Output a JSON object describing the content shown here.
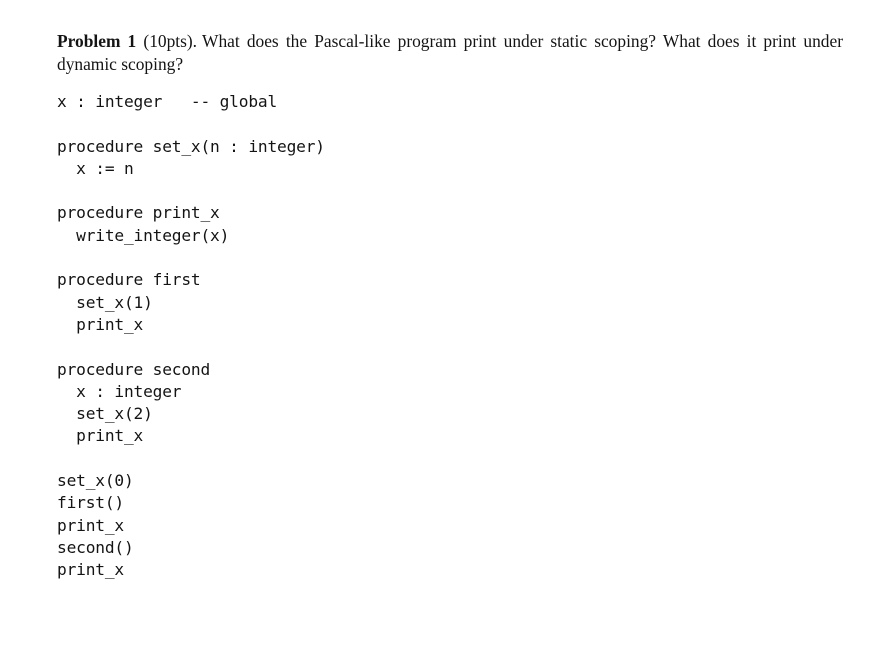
{
  "page": {
    "background_color": "#ffffff",
    "text_color": "#141414"
  },
  "problem": {
    "label": "Problem 1",
    "points": "(10pts).",
    "question": "What does the Pascal-like program print under static scoping? What does it print under dynamic scoping?"
  },
  "program": {
    "language": "Pascal-like pseudocode",
    "blocks": [
      {
        "name": "global-declaration",
        "lines": [
          "x : integer   -- global"
        ]
      },
      {
        "name": "procedure-set-x",
        "lines": [
          "procedure set_x(n : integer)",
          "  x := n"
        ]
      },
      {
        "name": "procedure-print-x",
        "lines": [
          "procedure print_x",
          "  write_integer(x)"
        ]
      },
      {
        "name": "procedure-first",
        "lines": [
          "procedure first",
          "  set_x(1)",
          "  print_x"
        ]
      },
      {
        "name": "procedure-second",
        "lines": [
          "procedure second",
          "  x : integer",
          "  set_x(2)",
          "  print_x"
        ]
      },
      {
        "name": "main-body",
        "lines": [
          "set_x(0)",
          "first()",
          "print_x",
          "second()",
          "print_x"
        ]
      }
    ]
  }
}
